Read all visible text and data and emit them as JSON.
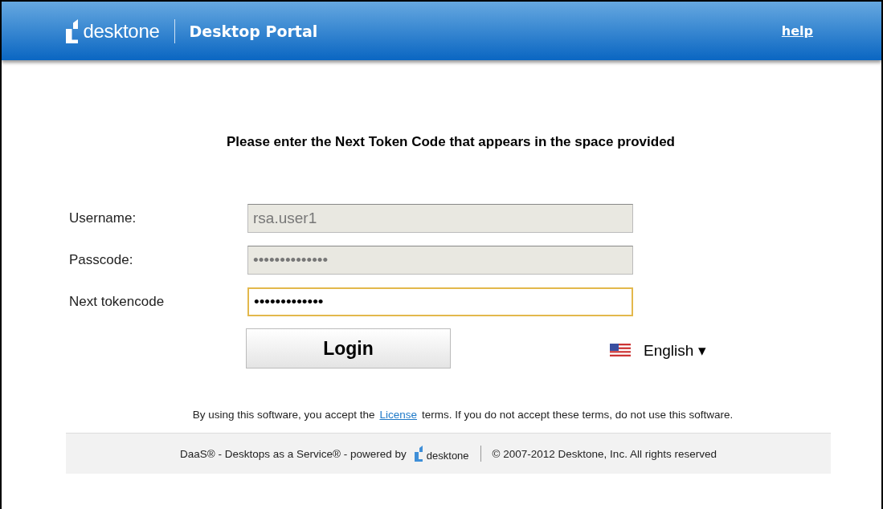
{
  "header": {
    "brand": "desktone",
    "title": "Desktop Portal",
    "help": "help"
  },
  "instruction": "Please enter the Next Token Code that appears in the space provided",
  "fields": [
    {
      "label": "Username:",
      "value": "rsa.user1",
      "disabled": true,
      "focused": false
    },
    {
      "label": "Passcode:",
      "value": "••••••••••••••",
      "disabled": true,
      "focused": false
    },
    {
      "label": "Next tokencode",
      "value": "•••••••••••••",
      "disabled": false,
      "focused": true
    }
  ],
  "login_button": "Login",
  "language": {
    "label": "English",
    "arrow": "▾"
  },
  "license": {
    "before": "By using this software, you accept the",
    "link": "License",
    "after": "terms. If you do not accept these terms, do not use this software."
  },
  "footer": {
    "tagline": "DaaS® - Desktops as a Service® - powered by",
    "brand": "desktone",
    "copyright": "© 2007-2012 Desktone, Inc. All rights reserved"
  }
}
